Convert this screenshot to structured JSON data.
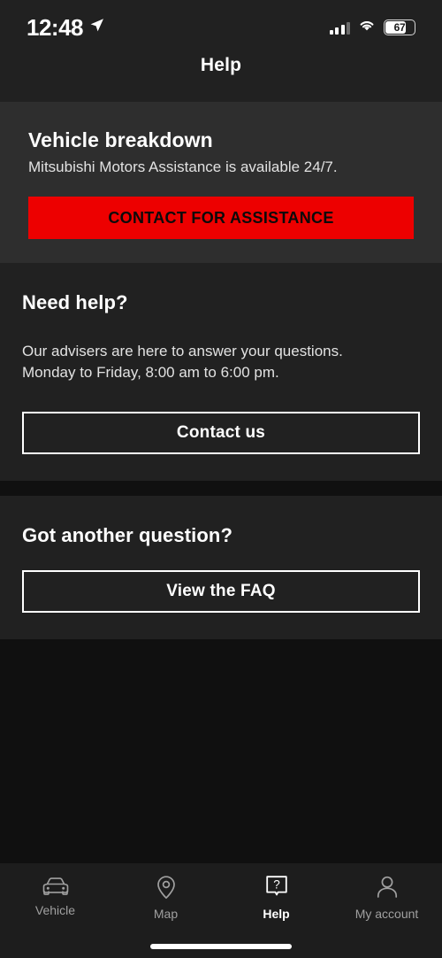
{
  "status_bar": {
    "time": "12:48",
    "location_icon": "location-arrow-icon",
    "signal_icon": "cellular-signal-icon",
    "wifi_icon": "wifi-icon",
    "battery_level": "67",
    "battery_percent": 67
  },
  "header": {
    "title": "Help"
  },
  "sections": {
    "breakdown": {
      "title": "Vehicle breakdown",
      "subtitle": "Mitsubishi Motors Assistance is available 24/7.",
      "button_label": "CONTACT FOR ASSISTANCE"
    },
    "need_help": {
      "title": "Need help?",
      "body_line1": "Our advisers are here to answer your questions.",
      "body_line2": "Monday to Friday, 8:00 am to 6:00 pm.",
      "button_label": "Contact us"
    },
    "another_question": {
      "title": "Got another question?",
      "button_label": "View the FAQ"
    }
  },
  "tab_bar": {
    "items": [
      {
        "label": "Vehicle",
        "icon": "car-icon",
        "active": false
      },
      {
        "label": "Map",
        "icon": "map-pin-icon",
        "active": false
      },
      {
        "label": "Help",
        "icon": "help-bubble-icon",
        "active": true
      },
      {
        "label": "My account",
        "icon": "person-icon",
        "active": false
      }
    ]
  },
  "colors": {
    "accent_red": "#ed0000",
    "card_light": "#2e2e2e",
    "card_dark": "#212121",
    "page_background": "#101010",
    "tabbar_background": "#1d1d1d"
  }
}
